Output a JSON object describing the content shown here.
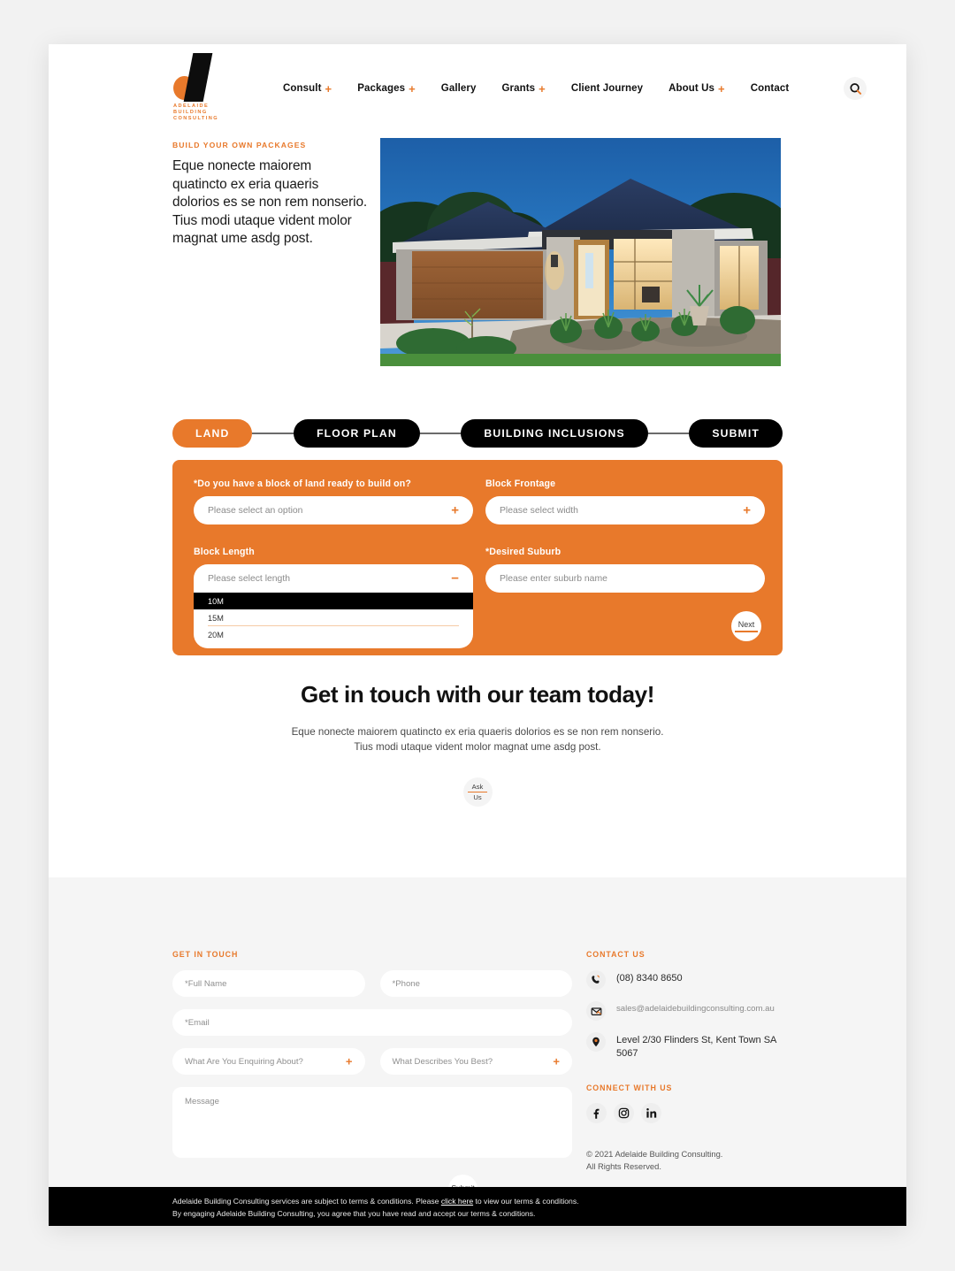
{
  "header": {
    "logo": {
      "line1": "ADELAIDE",
      "line2": "BUILDING",
      "line3": "CONSULTING"
    },
    "nav": [
      {
        "label": "Consult",
        "plus": "+"
      },
      {
        "label": "Packages",
        "plus": "+"
      },
      {
        "label": "Gallery",
        "plus": ""
      },
      {
        "label": "Grants",
        "plus": "+"
      },
      {
        "label": "Client Journey",
        "plus": ""
      },
      {
        "label": "About Us",
        "plus": "+"
      },
      {
        "label": "Contact",
        "plus": ""
      }
    ],
    "search_icon": "search-icon"
  },
  "hero": {
    "eyebrow": "BUILD YOUR OWN PACKAGES",
    "body": "Eque nonecte maiorem quatincto ex eria quaeris dolorios es se non rem nonserio. Tius modi utaque vident molor magnat ume asdg post.",
    "image_alt": "modern-single-storey-house-at-dusk"
  },
  "stepper": {
    "steps": [
      {
        "label": "LAND",
        "active": true
      },
      {
        "label": "FLOOR PLAN",
        "active": false
      },
      {
        "label": "BUILDING INCLUSIONS",
        "active": false
      },
      {
        "label": "SUBMIT",
        "active": false
      }
    ]
  },
  "land_form": {
    "block_ready": {
      "label": "*Do you have a block of land ready to build on?",
      "placeholder": "Please select an option",
      "sign": "+"
    },
    "block_frontage": {
      "label": "Block Frontage",
      "placeholder": "Please select width",
      "sign": "+"
    },
    "block_length": {
      "label": "Block Length",
      "placeholder": "Please select length",
      "sign": "−",
      "open": true,
      "options": [
        "10M",
        "15M",
        "20M"
      ],
      "selected_index": 0
    },
    "desired_suburb": {
      "label": "*Desired Suburb",
      "placeholder": "Please enter suburb name"
    },
    "next_button": "Next",
    "accent_color": "#E8792B"
  },
  "cta": {
    "title": "Get in touch with our team today!",
    "subtitle": "Eque nonecte maiorem quatincto ex eria quaeris dolorios es se non rem nonserio. Tius modi utaque vident molor magnat ume asdg post.",
    "button_line1": "Ask",
    "button_line2": "Us"
  },
  "footer": {
    "get_in_touch_heading": "GET IN TOUCH",
    "fields": {
      "full_name": "*Full Name",
      "phone": "*Phone",
      "email": "*Email",
      "enquiring_about": "What Are You Enquiring About?",
      "describes_you": "What Describes You Best?",
      "message": "Message",
      "sign": "+"
    },
    "submit_button": "Submit",
    "contact_heading": "CONTACT US",
    "contact": [
      {
        "icon": "phone-icon",
        "text": "(08) 8340 8650",
        "small": false
      },
      {
        "icon": "email-icon",
        "text": "sales@adelaidebuildingconsulting.com.au",
        "small": true
      },
      {
        "icon": "location-pin-icon",
        "text": "Level 2/30 Flinders St, Kent Town SA 5067",
        "small": false
      }
    ],
    "connect_heading": "CONNECT WITH US",
    "socials": [
      "facebook-icon",
      "instagram-icon",
      "linkedin-icon"
    ],
    "copyright_line1": "© 2021 Adelaide Building Consulting.",
    "copyright_line2": "All Rights Reserved."
  },
  "terms": {
    "line1_before": "Adelaide Building Consulting services are subject to terms & conditions. Please ",
    "link": "click here",
    "line1_after": " to view our terms & conditions.",
    "line2": "By engaging Adelaide Building Consulting, you agree that you have read and accept our terms & conditions."
  }
}
